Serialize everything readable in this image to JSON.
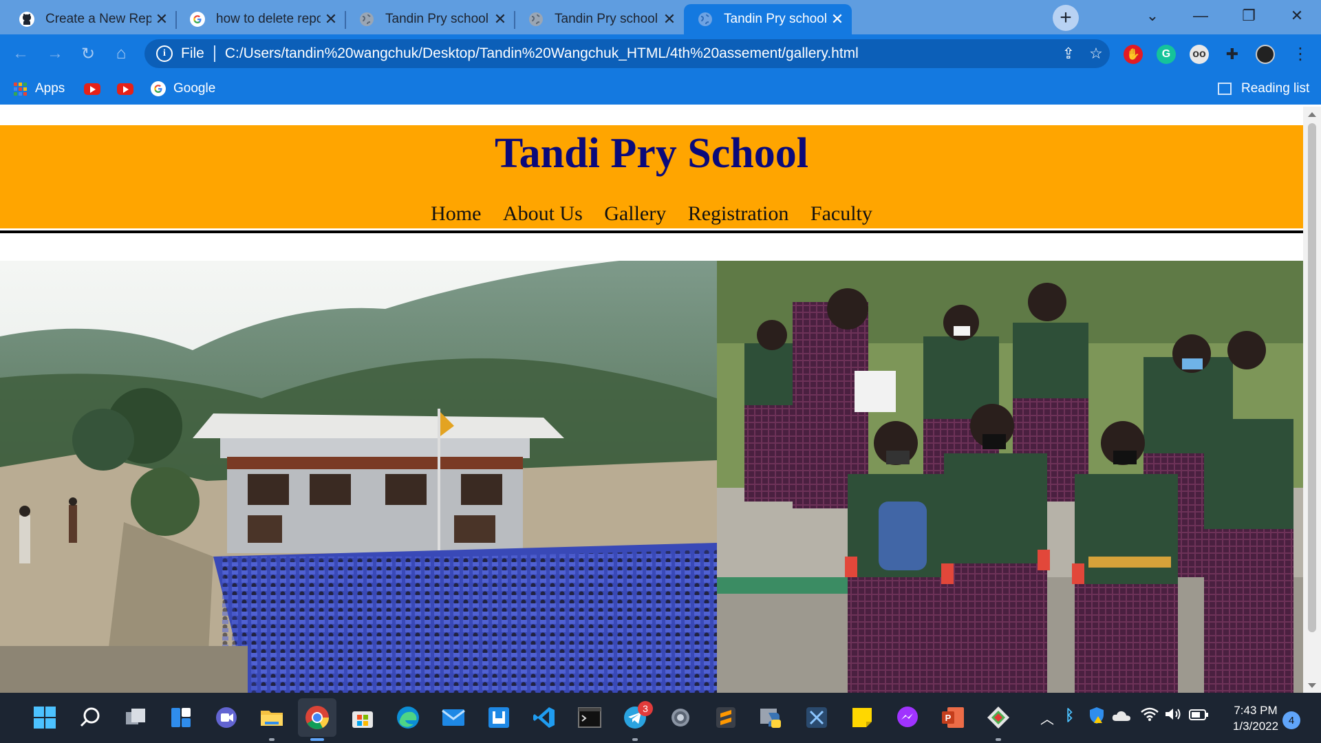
{
  "browser": {
    "tabs": [
      {
        "title": "Create a New Repository",
        "icon": "github-icon",
        "active": false
      },
      {
        "title": "how to delete repository i",
        "icon": "google-icon",
        "active": false
      },
      {
        "title": "Tandin Pry school",
        "icon": "globe-icon",
        "active": false
      },
      {
        "title": "Tandin Pry school",
        "icon": "globe-icon",
        "active": false
      },
      {
        "title": "Tandin Pry school",
        "icon": "globe-icon",
        "active": true
      }
    ],
    "new_tab_label": "+",
    "address": {
      "scheme": "File",
      "url": "C:/Users/tandin%20wangchuk/Desktop/Tandin%20Wangchuk_HTML/4th%20assement/gallery.html"
    },
    "bookmarks": {
      "apps_label": "Apps",
      "google_label": "Google",
      "reading_list_label": "Reading list"
    },
    "colors": {
      "tabstrip": "#5f9de0",
      "toolbar": "#1479e0",
      "accent": "#ffa500",
      "title": "#0b0a7a"
    }
  },
  "page": {
    "site_title": "Tandi Pry School",
    "nav": [
      "Home",
      "About Us",
      "Gallery",
      "Registration",
      "Faculty"
    ],
    "images": [
      {
        "name": "school-building-assembly-photo"
      },
      {
        "name": "students-in-uniform-photo"
      }
    ]
  },
  "taskbar": {
    "telegram_badge": "3",
    "time": "7:43 PM",
    "date": "1/3/2022",
    "notifications": "4"
  }
}
